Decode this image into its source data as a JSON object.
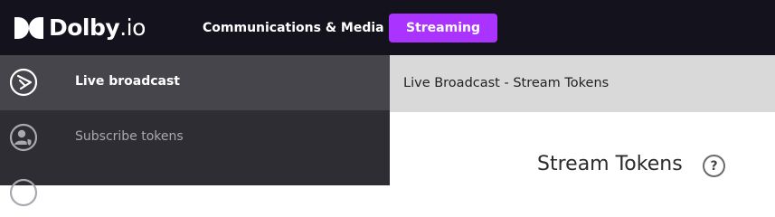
{
  "header": {
    "logo_brand": "Dolby",
    "logo_suffix": ".io",
    "nav": [
      {
        "label": "Communications & Media"
      },
      {
        "label": "Streaming"
      }
    ]
  },
  "sidebar": {
    "items": [
      {
        "label": "Live broadcast",
        "icon": "broadcast-icon",
        "active": true
      },
      {
        "label": "Subscribe tokens",
        "icon": "user-shield-icon",
        "active": false
      },
      {
        "label": "",
        "icon": "circle-icon",
        "active": false
      }
    ]
  },
  "breadcrumb": {
    "text": "Live Broadcast - Stream Tokens"
  },
  "main": {
    "title": "Stream Tokens",
    "help_label": "?"
  },
  "colors": {
    "topbar": "#14121c",
    "accent": "#aa33ff",
    "sidebar": "#2e2d33",
    "sidebar_active": "#46454b",
    "breadcrumb_bg": "#d9d9d9"
  }
}
